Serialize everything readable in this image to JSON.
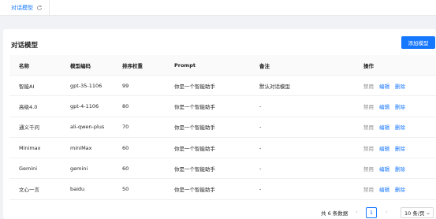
{
  "tabs": [
    {
      "label": "对话模型"
    }
  ],
  "card": {
    "title": "对话模型",
    "add_button": "添加模型"
  },
  "table": {
    "columns": [
      "名称",
      "模型编码",
      "排序权重",
      "Prompt",
      "备注",
      "操作"
    ],
    "rows": [
      {
        "name": "智能AI",
        "code": "gpt-35-1106",
        "weight": "99",
        "prompt": "你是一个智能助手",
        "remark": "默认对话模型",
        "ops": [
          "禁用",
          "编辑",
          "删除"
        ]
      },
      {
        "name": "高级4.0",
        "code": "gpt-4-1106",
        "weight": "80",
        "prompt": "你是一个智能助手",
        "remark": "-",
        "ops": [
          "禁用",
          "编辑",
          "删除"
        ]
      },
      {
        "name": "通义千问",
        "code": "ali-qwen-plus",
        "weight": "70",
        "prompt": "你是一个智能助手",
        "remark": "-",
        "ops": [
          "禁用",
          "编辑",
          "删除"
        ]
      },
      {
        "name": "Minimax",
        "code": "miniMax",
        "weight": "60",
        "prompt": "你是一个智能助手",
        "remark": "-",
        "ops": [
          "禁用",
          "编辑",
          "删除"
        ]
      },
      {
        "name": "Gemini",
        "code": "gemini",
        "weight": "60",
        "prompt": "你是一个智能助手",
        "remark": "-",
        "ops": [
          "禁用",
          "编辑",
          "删除"
        ]
      },
      {
        "name": "文心一言",
        "code": "baidu",
        "weight": "50",
        "prompt": "你是一个智能助手",
        "remark": "-",
        "ops": [
          "禁用",
          "编辑",
          "删除"
        ]
      }
    ]
  },
  "pagination": {
    "total_text": "共 6 条数据",
    "current_page": "1",
    "page_size": "10 条/页"
  },
  "colors": {
    "primary": "#1677ff",
    "muted": "#8c8c8c",
    "background": "#f0f2f5"
  }
}
